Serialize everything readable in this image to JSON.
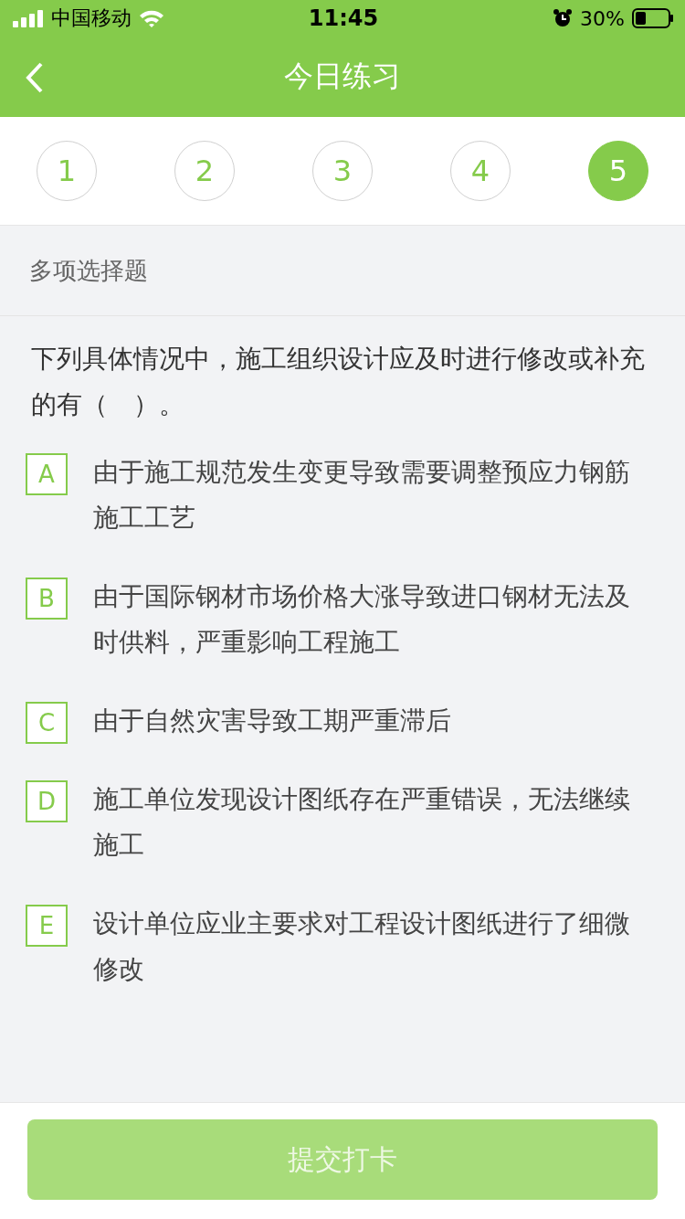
{
  "status_bar": {
    "carrier": "中国移动",
    "time": "11:45",
    "battery": "30%"
  },
  "nav": {
    "title": "今日练习"
  },
  "question_tabs": [
    {
      "label": "1",
      "selected": false
    },
    {
      "label": "2",
      "selected": false
    },
    {
      "label": "3",
      "selected": false
    },
    {
      "label": "4",
      "selected": false
    },
    {
      "label": "5",
      "selected": true
    }
  ],
  "section_title": "多项选择题",
  "question": "下列具体情况中，施工组织设计应及时进行修改或补充的有（　）。",
  "options": [
    {
      "letter": "A",
      "text": "由于施工规范发生变更导致需要调整预应力钢筋施工工艺",
      "selected": false
    },
    {
      "letter": "B",
      "text": "由于国际钢材市场价格大涨导致进口钢材无法及时供料，严重影响工程施工",
      "selected": false
    },
    {
      "letter": "C",
      "text": "由于自然灾害导致工期严重滞后",
      "selected": false
    },
    {
      "letter": "D",
      "text": "施工单位发现设计图纸存在严重错误，无法继续施工",
      "selected": false
    },
    {
      "letter": "E",
      "text": "设计单位应业主要求对工程设计图纸进行了细微修改",
      "selected": false
    }
  ],
  "submit": {
    "label": "提交打卡",
    "disabled": true
  }
}
